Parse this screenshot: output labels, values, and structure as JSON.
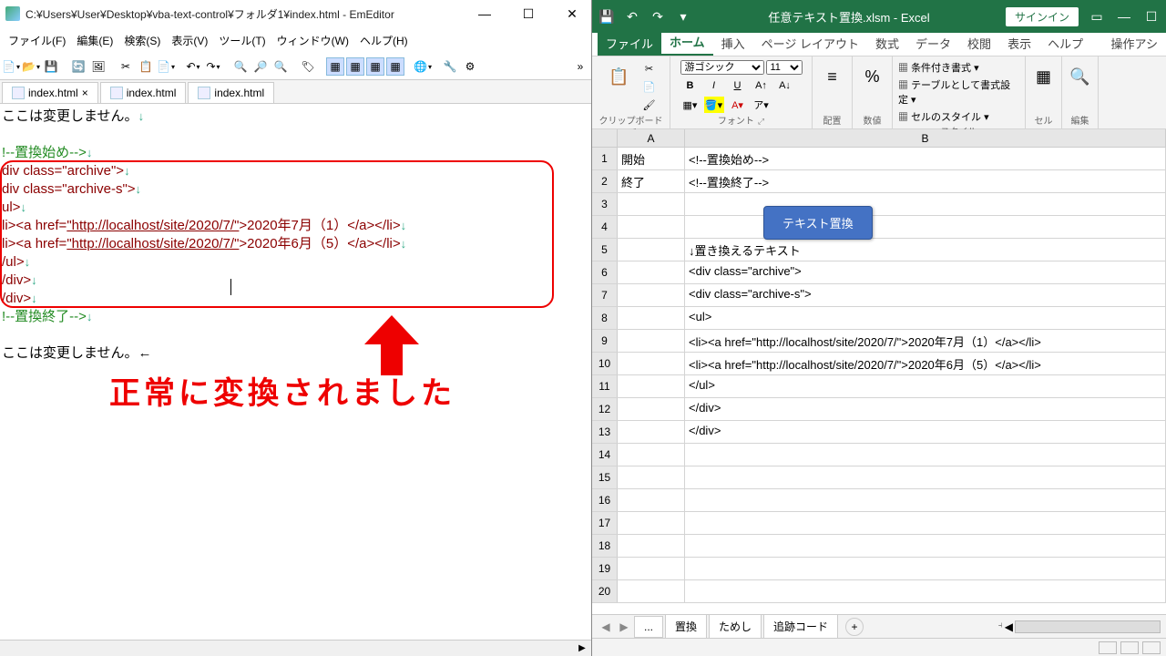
{
  "emeditor": {
    "title": "C:¥Users¥User¥Desktop¥vba-text-control¥フォルダ1¥index.html - EmEditor",
    "menu": [
      "ファイル(F)",
      "編集(E)",
      "検索(S)",
      "表示(V)",
      "ツール(T)",
      "ウィンドウ(W)",
      "ヘルプ(H)"
    ],
    "tabs": [
      "index.html",
      "index.html",
      "index.html"
    ],
    "caption": "正常に変換されました",
    "code": {
      "l1": "ここは変更しません。",
      "l2": "!--置換始め-->",
      "l3a": "div class=",
      "l3b": "\"archive\"",
      "l3c": ">",
      "l4a": "div class=",
      "l4b": "\"archive-s\"",
      "l4c": ">",
      "l5": "ul>",
      "l6a": "li><a href=",
      "l6url": "\"http://localhost/site/2020/7/\"",
      "l6b": ">2020年7月（1）</a></li>",
      "l7a": "li><a href=",
      "l7url": "\"http://localhost/site/2020/7/\"",
      "l7b": ">2020年6月（5）</a></li>",
      "l8": "/ul>",
      "l9": "/div>",
      "l10": "/div>",
      "l11": "!--置換終了-->",
      "l12": "ここは変更しません。←"
    }
  },
  "excel": {
    "title": "任意テキスト置換.xlsm - Excel",
    "signin": "サインイン",
    "ribbon_tabs": [
      "ファイル",
      "ホーム",
      "挿入",
      "ページ レイアウト",
      "数式",
      "データ",
      "校閲",
      "表示",
      "ヘルプ",
      "操作アシ"
    ],
    "font": {
      "name": "游ゴシック",
      "size": "11"
    },
    "groups": {
      "clipboard": "クリップボード",
      "font": "フォント",
      "align": "配置",
      "number": "数値",
      "style": "スタイル",
      "cell": "セル",
      "edit": "編集"
    },
    "cond_fmt": "条件付き書式",
    "tbl_fmt": "テーブルとして書式設定",
    "cell_style": "セルのスタイル",
    "cols": [
      "A",
      "B"
    ],
    "button": "テキスト置換",
    "rows": [
      {
        "n": "1",
        "a": "開始",
        "b": "<!--置換始め-->"
      },
      {
        "n": "2",
        "a": "終了",
        "b": "<!--置換終了-->"
      },
      {
        "n": "3",
        "a": "",
        "b": ""
      },
      {
        "n": "4",
        "a": "",
        "b": ""
      },
      {
        "n": "5",
        "a": "",
        "b": "↓置き換えるテキスト"
      },
      {
        "n": "6",
        "a": "",
        "b": "<div class=\"archive\">"
      },
      {
        "n": "7",
        "a": "",
        "b": "<div class=\"archive-s\">"
      },
      {
        "n": "8",
        "a": "",
        "b": "<ul>"
      },
      {
        "n": "9",
        "a": "",
        "b": "<li><a href=\"http://localhost/site/2020/7/\">2020年7月（1）</a></li>"
      },
      {
        "n": "10",
        "a": "",
        "b": "<li><a href=\"http://localhost/site/2020/7/\">2020年6月（5）</a></li>"
      },
      {
        "n": "11",
        "a": "",
        "b": "</ul>"
      },
      {
        "n": "12",
        "a": "",
        "b": "</div>"
      },
      {
        "n": "13",
        "a": "",
        "b": "</div>"
      },
      {
        "n": "14",
        "a": "",
        "b": ""
      },
      {
        "n": "15",
        "a": "",
        "b": ""
      },
      {
        "n": "16",
        "a": "",
        "b": ""
      },
      {
        "n": "17",
        "a": "",
        "b": ""
      },
      {
        "n": "18",
        "a": "",
        "b": ""
      },
      {
        "n": "19",
        "a": "",
        "b": ""
      },
      {
        "n": "20",
        "a": "",
        "b": ""
      }
    ],
    "sheets": [
      "...",
      "置換",
      "ためし",
      "追跡コード"
    ]
  }
}
